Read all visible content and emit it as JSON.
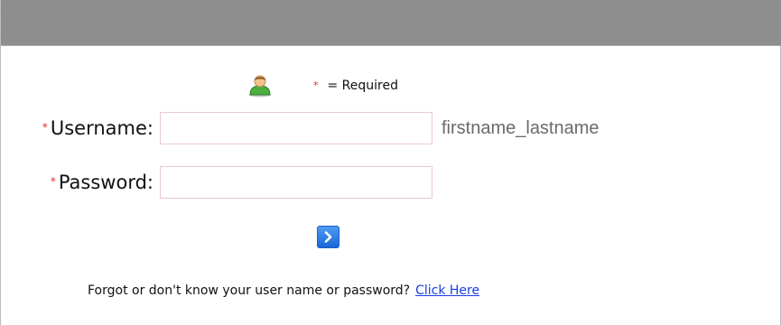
{
  "legend": {
    "icon": "user-icon",
    "star": "*",
    "required_text": "= Required"
  },
  "form": {
    "required_star": "*",
    "username_label": "Username:",
    "username_value": "",
    "username_hint": "firstname_lastname",
    "password_label": "Password:",
    "password_value": "",
    "submit_icon": "chevron-right-icon"
  },
  "footer": {
    "forgot_text": "Forgot or don't know your user name or password?",
    "link_text": "Click Here"
  },
  "colors": {
    "header_bar": "#8e8e8e",
    "required_star": "#e02a2a",
    "link": "#1a3de0",
    "button": "#2a7ae6"
  }
}
